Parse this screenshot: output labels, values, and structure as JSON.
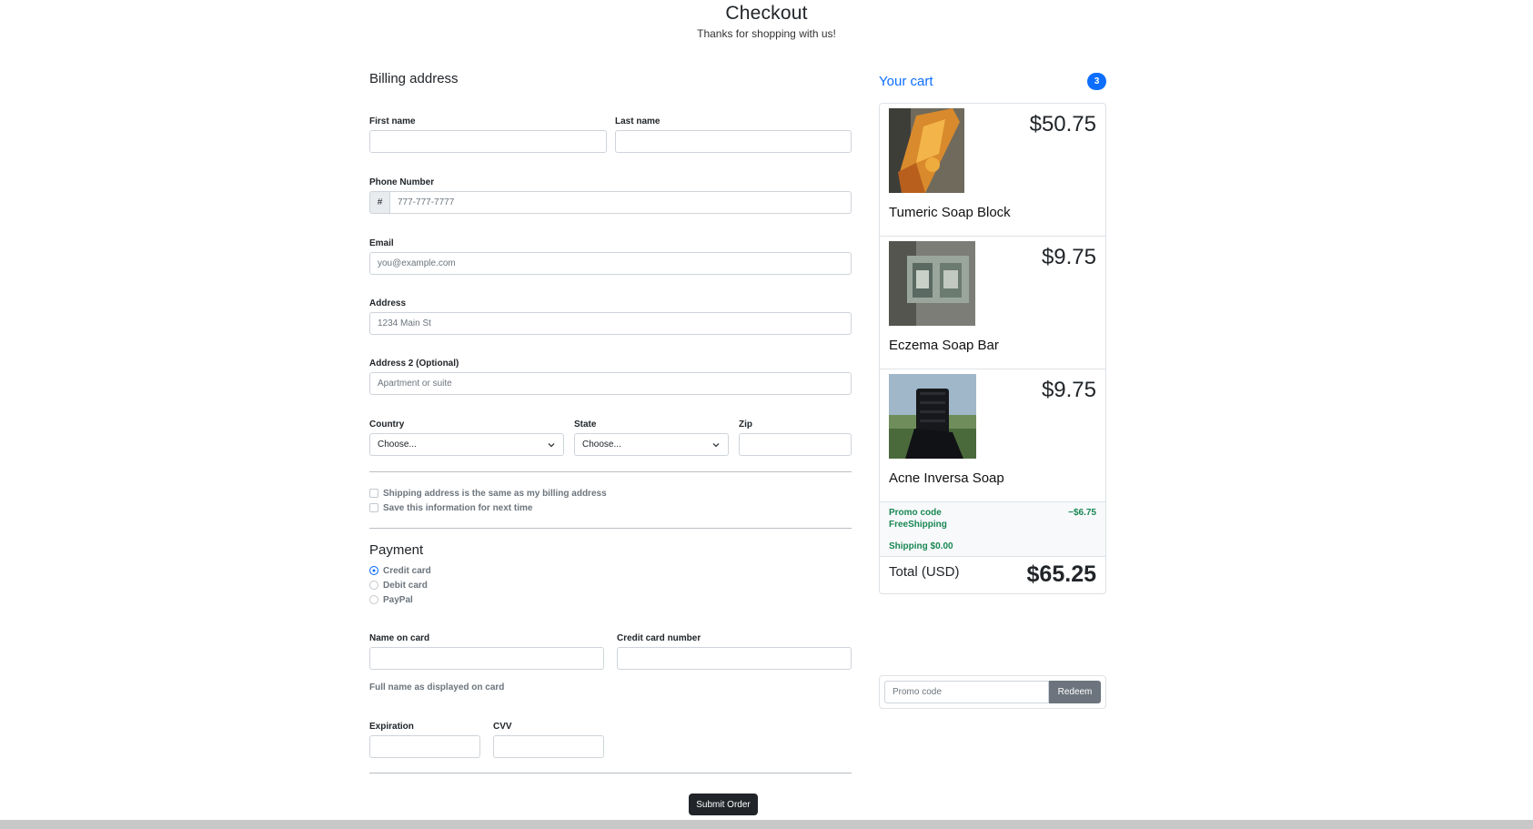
{
  "header": {
    "title": "Checkout",
    "subtitle": "Thanks for shopping with us!"
  },
  "billing": {
    "title": "Billing address",
    "first_name_label": "First name",
    "last_name_label": "Last name",
    "phone_label": "Phone Number",
    "phone_prefix": "#",
    "phone_placeholder": "777-777-7777",
    "email_label": "Email",
    "email_placeholder": "you@example.com",
    "address_label": "Address",
    "address_placeholder": "1234 Main St",
    "address2_label": "Address 2 (Optional)",
    "address2_placeholder": "Apartment or suite",
    "country_label": "Country",
    "country_value": "Choose...",
    "state_label": "State",
    "state_value": "Choose...",
    "zip_label": "Zip",
    "same_address_label": "Shipping address is the same as my billing address",
    "save_info_label": "Save this information for next time"
  },
  "payment": {
    "title": "Payment",
    "methods": [
      "Credit card",
      "Debit card",
      "PayPal"
    ],
    "selected": "Credit card",
    "name_on_card_label": "Name on card",
    "card_number_label": "Credit card number",
    "name_help": "Full name as displayed on card",
    "expiration_label": "Expiration",
    "cvv_label": "CVV",
    "submit_label": "Submit Order"
  },
  "cart": {
    "title": "Your cart",
    "count": "3",
    "items": [
      {
        "name": "Tumeric Soap Block",
        "price": "$50.75"
      },
      {
        "name": "Eczema Soap Bar",
        "price": "$9.75"
      },
      {
        "name": "Acne Inversa Soap",
        "price": "$9.75"
      }
    ],
    "promo_label": "Promo code",
    "promo_code": "FreeShipping",
    "promo_discount": "−$6.75",
    "shipping": "Shipping $0.00",
    "total_label": "Total (USD)",
    "total_value": "$65.25",
    "redeem_placeholder": "Promo code",
    "redeem_label": "Redeem"
  },
  "colors": {
    "accent": "#0d6efd",
    "success": "#198754",
    "dark": "#212529",
    "muted": "#6c757d"
  }
}
